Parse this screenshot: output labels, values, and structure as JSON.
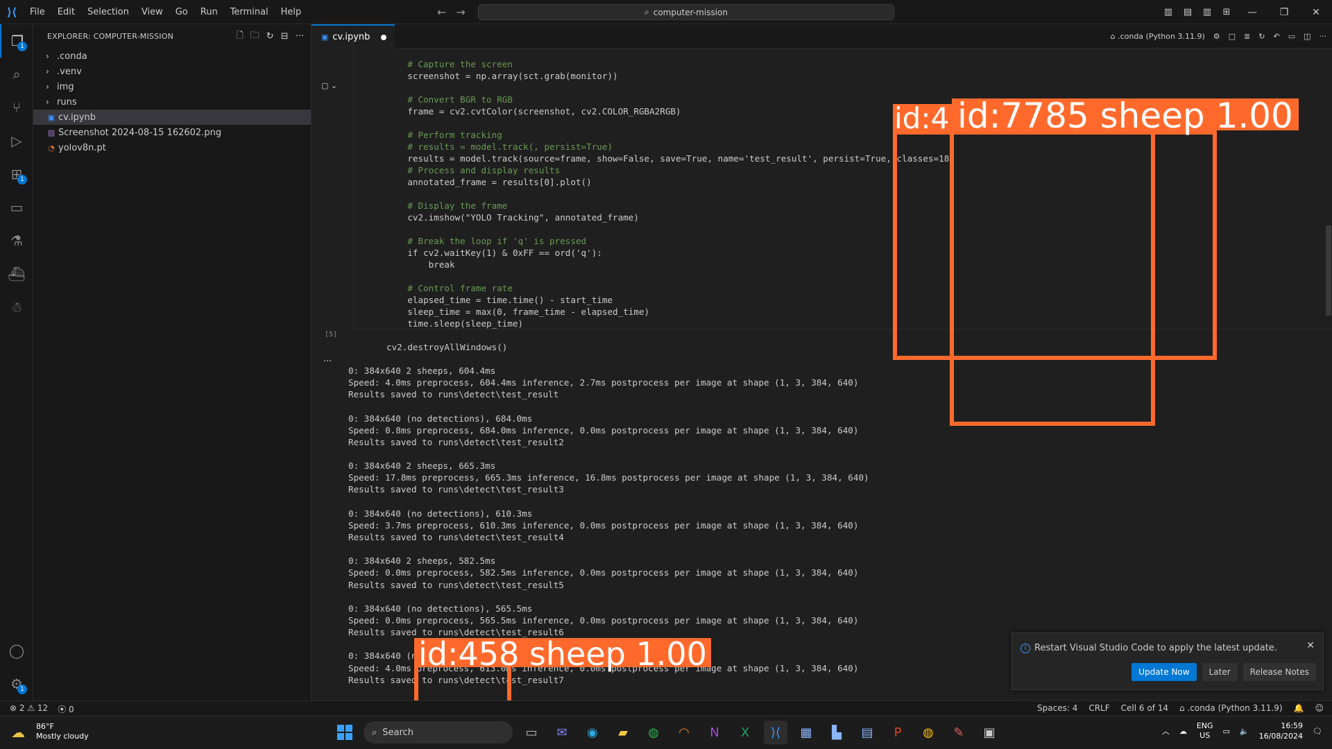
{
  "titlebar": {
    "menu": [
      "File",
      "Edit",
      "Selection",
      "View",
      "Go",
      "Run",
      "Terminal",
      "Help"
    ],
    "search_text": "computer-mission"
  },
  "activity": {
    "explorer_badge": "1",
    "extensions_badge": "1",
    "settings_badge": "1"
  },
  "explorer": {
    "header": "EXPLORER: COMPUTER-MISSION",
    "folders": [
      ".conda",
      ".venv",
      "img",
      "runs"
    ],
    "files": [
      "cv.ipynb",
      "Screenshot 2024-08-15 162602.png",
      "yolov8n.pt"
    ]
  },
  "editor": {
    "tab_label": "cv.ipynb",
    "kernel_label": ".conda (Python 3.11.9)",
    "exec_count": "[5]",
    "output_more": "..."
  },
  "code_lines": [
    "    # Capture the screen",
    "    screenshot = np.array(sct.grab(monitor))",
    "",
    "    # Convert BGR to RGB",
    "    frame = cv2.cvtColor(screenshot, cv2.COLOR_RGBA2RGB)",
    "",
    "    # Perform tracking",
    "    # results = model.track(, persist=True)",
    "    results = model.track(source=frame, show=False, save=True, name='test_result', persist=True, classes=18)",
    "    # Process and display results",
    "    annotated_frame = results[0].plot()",
    "",
    "    # Display the frame",
    "    cv2.imshow(\"YOLO Tracking\", annotated_frame)",
    "",
    "    # Break the loop if 'q' is pressed",
    "    if cv2.waitKey(1) & 0xFF == ord('q'):",
    "        break",
    "",
    "    # Control frame rate",
    "    elapsed_time = time.time() - start_time",
    "    sleep_time = max(0, frame_time - elapsed_time)",
    "    time.sleep(sleep_time)",
    "",
    "cv2.destroyAllWindows()"
  ],
  "output_lines": [
    "0: 384x640 2 sheeps, 604.4ms",
    "Speed: 4.0ms preprocess, 604.4ms inference, 2.7ms postprocess per image at shape (1, 3, 384, 640)",
    "Results saved to runs\\detect\\test_result",
    "",
    "0: 384x640 (no detections), 684.0ms",
    "Speed: 0.8ms preprocess, 684.0ms inference, 0.0ms postprocess per image at shape (1, 3, 384, 640)",
    "Results saved to runs\\detect\\test_result2",
    "",
    "0: 384x640 2 sheeps, 665.3ms",
    "Speed: 17.8ms preprocess, 665.3ms inference, 16.8ms postprocess per image at shape (1, 3, 384, 640)",
    "Results saved to runs\\detect\\test_result3",
    "",
    "0: 384x640 (no detections), 610.3ms",
    "Speed: 3.7ms preprocess, 610.3ms inference, 0.0ms postprocess per image at shape (1, 3, 384, 640)",
    "Results saved to runs\\detect\\test_result4",
    "",
    "0: 384x640 2 sheeps, 582.5ms",
    "Speed: 0.0ms preprocess, 582.5ms inference, 0.0ms postprocess per image at shape (1, 3, 384, 640)",
    "Results saved to runs\\detect\\test_result5",
    "",
    "0: 384x640 (no detections), 565.5ms",
    "Speed: 0.0ms preprocess, 565.5ms inference, 0.0ms postprocess per image at shape (1, 3, 384, 640)",
    "Results saved to runs\\detect\\test_result6",
    "",
    "0: 384x640 (no detections), 613.0ms",
    "Speed: 4.0ms preprocess, 613.0ms inference, 0.0ms postprocess per image at shape (1, 3, 384, 640)",
    "Results saved to runs\\detect\\test_result7"
  ],
  "overlays": {
    "label_partial": "id:4",
    "label_top": "id:7785 sheep 1.00",
    "label_bottom": "id:458 sheep 1.00",
    "color": "#ff6a2c"
  },
  "notification": {
    "message": "Restart Visual Studio Code to apply the latest update.",
    "update_now": "Update Now",
    "later": "Later",
    "release_notes": "Release Notes"
  },
  "statusbar": {
    "errors": "2",
    "warnings": "12",
    "ports": "0",
    "spaces": "Spaces: 4",
    "eol": "CRLF",
    "cell": "Cell 6 of 14",
    "kernel": ".conda (Python 3.11.9)"
  },
  "taskbar": {
    "temperature": "86°F",
    "weather": "Mostly cloudy",
    "search_placeholder": "Search",
    "lang": "ENG",
    "region": "US",
    "time": "16:59",
    "date": "16/08/2024"
  }
}
